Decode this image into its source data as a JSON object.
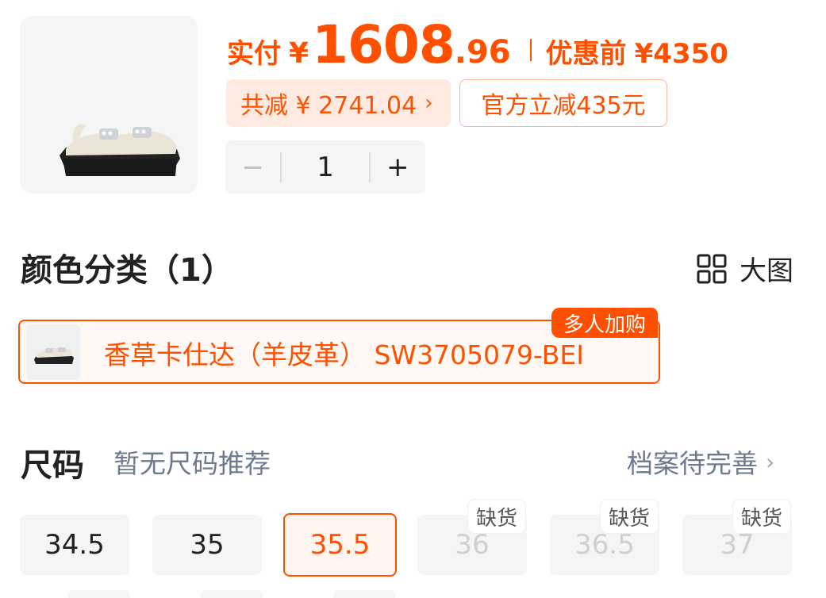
{
  "price": {
    "label": "实付",
    "currency": "¥",
    "integer": "1608",
    "decimal": ".96",
    "original_label": "优惠前",
    "original": "¥4350"
  },
  "discount": {
    "total": "共减 ¥ 2741.04",
    "chevron": "›",
    "official": "官方立减435元"
  },
  "quantity": {
    "minus": "−",
    "value": "1",
    "plus": "+"
  },
  "color_section": {
    "title": "颜色分类（1）",
    "big_image_label": "大图",
    "variants": [
      {
        "name": "香草卡仕达（羊皮革） SW3705079-BEI",
        "badge": "多人加购",
        "selected": true
      }
    ]
  },
  "size_section": {
    "title": "尺码",
    "subtitle": "暂无尺码推荐",
    "profile_link": "档案待完善",
    "chevron": "›",
    "sizes": [
      {
        "label": "34.5",
        "state": "available"
      },
      {
        "label": "35",
        "state": "available"
      },
      {
        "label": "35.5",
        "state": "selected"
      },
      {
        "label": "36",
        "state": "out_of_stock",
        "tag": "缺货"
      },
      {
        "label": "36.5",
        "state": "out_of_stock",
        "tag": "缺货"
      },
      {
        "label": "37",
        "state": "out_of_stock",
        "tag": "缺货"
      }
    ]
  },
  "colors": {
    "accent": "#ff5000",
    "accent_light": "#ffeae2",
    "chip_bg": "#f5f5f5",
    "muted_text": "#6d7a8d"
  },
  "icons": {
    "grid": "grid-icon",
    "chevron": "chevron-right-icon",
    "product": "sandal-image"
  }
}
